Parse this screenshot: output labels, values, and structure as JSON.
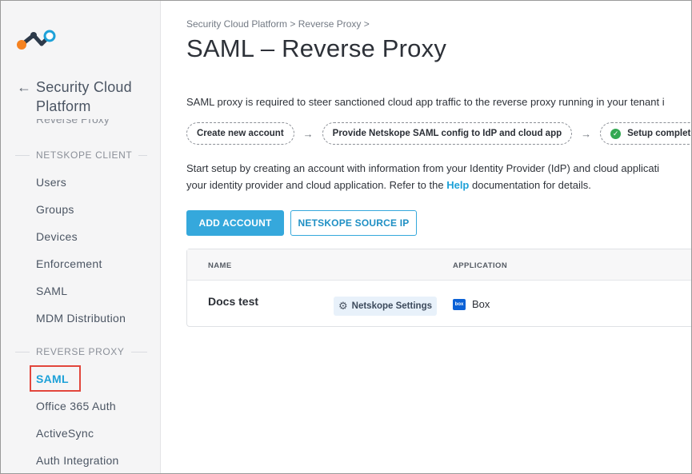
{
  "sidebar": {
    "title": "Security Cloud Platform",
    "hidden_item": "Reverse Proxy",
    "sections": [
      {
        "label": "NETSKOPE CLIENT",
        "items": [
          {
            "label": "Users"
          },
          {
            "label": "Groups"
          },
          {
            "label": "Devices"
          },
          {
            "label": "Enforcement"
          },
          {
            "label": "SAML"
          },
          {
            "label": "MDM Distribution"
          }
        ]
      },
      {
        "label": "REVERSE PROXY",
        "items": [
          {
            "label": "SAML",
            "active": true
          },
          {
            "label": "Office 365 Auth"
          },
          {
            "label": "ActiveSync"
          },
          {
            "label": "Auth Integration"
          }
        ]
      }
    ]
  },
  "main": {
    "breadcrumb": "Security Cloud Platform > Reverse Proxy >",
    "title": "SAML – Reverse Proxy",
    "description": "SAML proxy is required to steer sanctioned cloud app traffic to the reverse proxy running in your tenant i",
    "steps": [
      {
        "label": "Create new account"
      },
      {
        "label": "Provide Netskope SAML config to IdP and cloud app"
      },
      {
        "label": "Setup complete",
        "complete": true
      }
    ],
    "setup_text_line1": "Start setup by creating an account with information from your Identity Provider (IdP) and cloud applicati",
    "setup_text_line2_prefix": "your identity provider and cloud application. Refer to the ",
    "help_link": "Help",
    "setup_text_line2_suffix": " documentation for details.",
    "buttons": {
      "add_account": "ADD ACCOUNT",
      "netskope_source_ip": "NETSKOPE SOURCE IP"
    },
    "table": {
      "columns": [
        "NAME",
        "APPLICATION"
      ],
      "rows": [
        {
          "name": "Docs test",
          "settings_label": "Netskope Settings",
          "application": "Box",
          "app_icon_text": "box"
        }
      ]
    }
  },
  "colors": {
    "accent": "#1da1d8",
    "primary_button": "#35a8dc",
    "highlight": "#e2463c",
    "success": "#34a853"
  }
}
